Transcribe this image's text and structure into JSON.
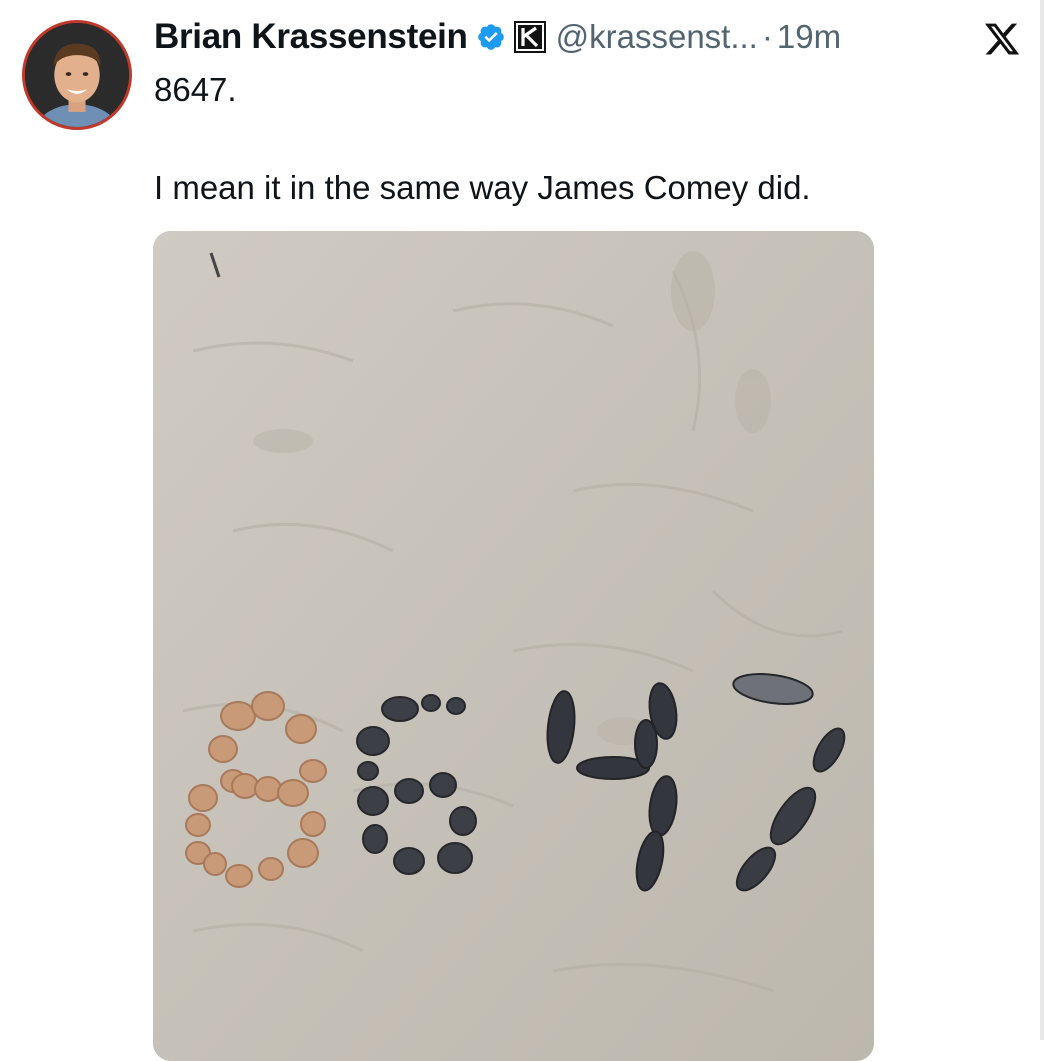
{
  "tweet": {
    "author": {
      "display_name": "Brian Krassenstein",
      "handle": "@krassenst...",
      "verified_icon": "verified-badge-icon",
      "affiliation_icon": "k-affiliation-icon",
      "verified_color": "#1d9bf0"
    },
    "separator": "·",
    "timestamp": "19m",
    "platform_icon": "x-logo-icon",
    "text_line_1": "8647.",
    "text_line_2": "I mean it in the same way James Comey did.",
    "media": {
      "description_icon": "beach-photo",
      "shown_number": "8647"
    }
  },
  "colors": {
    "text": "#0f1419",
    "secondary_text": "#536471",
    "sand": "#c9c4bb"
  }
}
